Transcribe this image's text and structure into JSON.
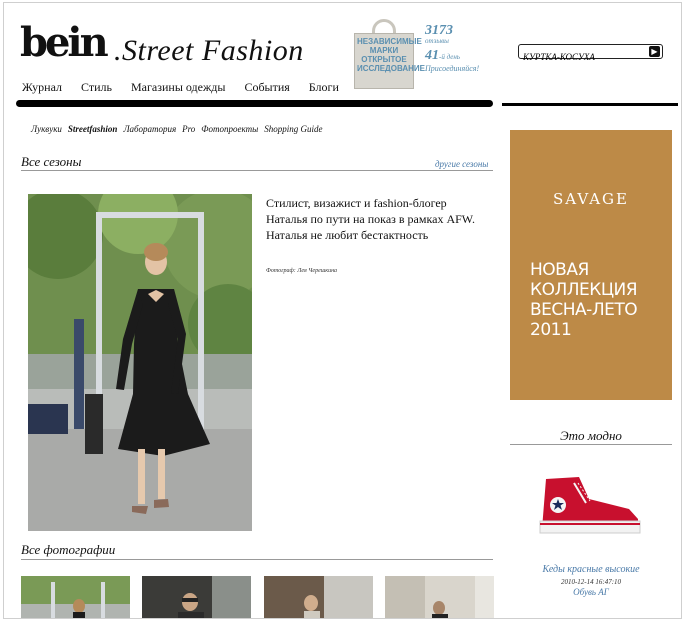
{
  "header": {
    "logo": "bein",
    "site_name": ".Street Fashion",
    "bag_text": "НЕЗАВИСИМЫЕ МАРКИ ОТКРЫТОЕ ИССЛЕДОВАНИЕ",
    "stats": {
      "count": "3173",
      "count_label": "отзывы",
      "daily": "41",
      "daily_label": "-й день",
      "join": "Присоединяйся!"
    },
    "search": {
      "value": "КУРТКА-КОСУХА"
    }
  },
  "nav": {
    "items": [
      "Журнал",
      "Стиль",
      "Магазины одежды",
      "События",
      "Блоги"
    ]
  },
  "subnav": {
    "items": [
      "Луквуки",
      "Streetfashion",
      "Лаборатория",
      "Pro",
      "Фотопроекты",
      "Shopping Guide"
    ]
  },
  "main": {
    "section_title": "Все сезоны",
    "other_seasons": "другие сезоны",
    "caption": "Стилист, визажист и fashion-блогер Наталья по пути на показ в рамках AFW. Наталья не любит бестактность",
    "credit": "Фотограф: Лея Черешкина",
    "all_photos_title": "Все фотографии"
  },
  "sidebar": {
    "ad": {
      "brand": "SAVAGE",
      "text": "НОВАЯ КОЛЛЕКЦИЯ ВЕСНА-ЛЕТО 2011",
      "color": "#bd8a47"
    },
    "trend_title": "Это модно",
    "product": {
      "name": "Кеды красные высокие",
      "date": "2010-12-14 16:47:10",
      "brand": "Обувь АГ"
    }
  },
  "colors": {
    "link": "#4a7aa8",
    "stats": "#5a8fb0"
  }
}
